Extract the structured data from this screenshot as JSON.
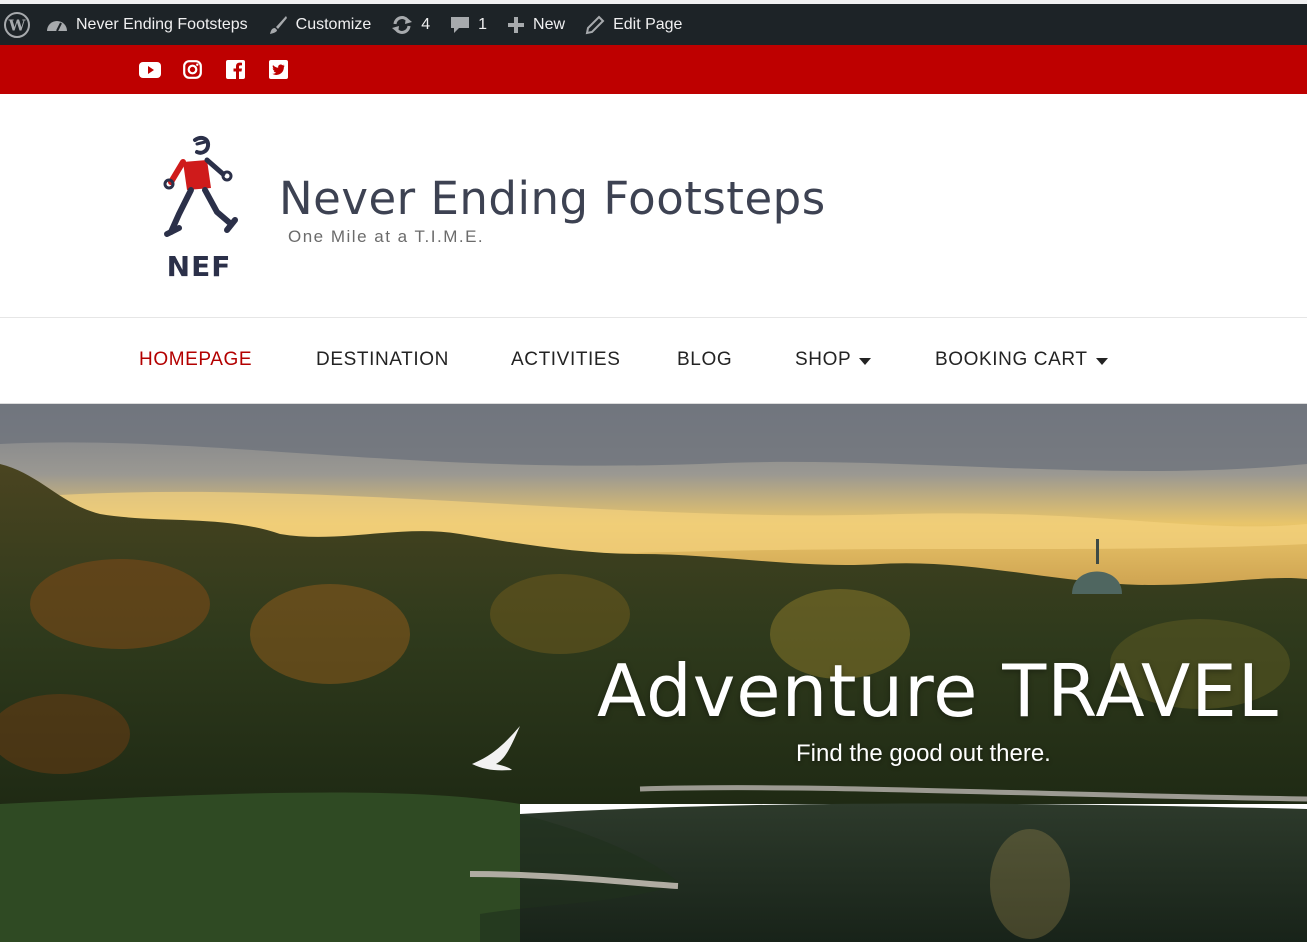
{
  "admin_bar": {
    "site_name": "Never Ending Footsteps",
    "customize": "Customize",
    "updates_count": "4",
    "comments_count": "1",
    "new_label": "New",
    "edit_page": "Edit Page"
  },
  "social": [
    "youtube-icon",
    "instagram-icon",
    "facebook-icon",
    "twitter-icon"
  ],
  "header": {
    "logo_text": "NEF",
    "site_title": "Never Ending Footsteps",
    "tagline": "One Mile at a T.I.M.E."
  },
  "nav": {
    "items": [
      {
        "label": "HOMEPAGE",
        "active": true
      },
      {
        "label": "DESTINATION"
      },
      {
        "label": "ACTIVITIES"
      },
      {
        "label": "BLOG"
      },
      {
        "label": "SHOP",
        "dropdown": true
      },
      {
        "label": "BOOKING CART",
        "dropdown": true
      }
    ]
  },
  "hero": {
    "title": "Adventure TRAVEL",
    "subtitle": "Find the good out there."
  },
  "colors": {
    "admin_bar": "#1d2327",
    "social_bar": "#be0000",
    "nav_active": "#b30000",
    "title": "#3d4252"
  }
}
